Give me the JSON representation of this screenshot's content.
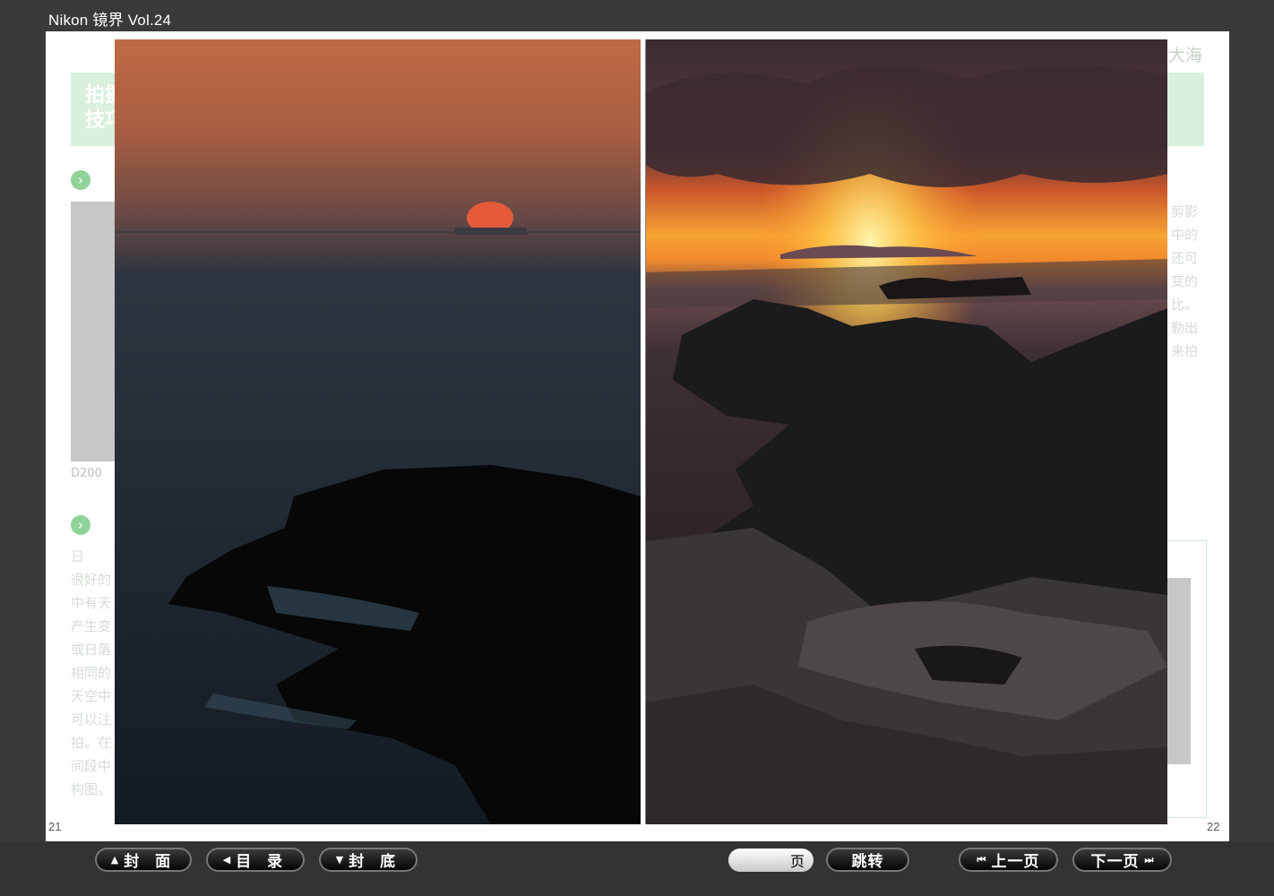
{
  "app_title": "Nikon 镜界 Vol.24",
  "left_page": {
    "banner_text": "拍摄\n技巧",
    "caption": "D200",
    "ghost_lines": "日\n很好的\n中有天\n产生变\n或日落\n相同的\n天空中\n可以注\n拍。在\n间段中\n构图。",
    "page_number": "21"
  },
  "right_page": {
    "header_text": "大海",
    "ghost_lines": "剪影\n中的\n还可\n变的\n比。\n勒出\n来拍",
    "page_number": "22"
  },
  "toolbar": {
    "cover_label": "封 面",
    "toc_label": "目 录",
    "back_cover_label": "封 底",
    "page_field_value": "",
    "page_suffix": "页",
    "jump_label": "跳转",
    "prev_label": "上一页",
    "next_label": "下一页"
  },
  "icons": {
    "cover": "arrow-up-icon",
    "toc": "arrow-left-icon",
    "back_cover": "arrow-down-icon",
    "prev": "skip-back-icon",
    "next": "skip-forward-icon"
  },
  "colors": {
    "background": "#3a3a3a",
    "accent_green": "#8fd39a",
    "banner_green": "#d9f0dc",
    "button_border": "#777777"
  }
}
